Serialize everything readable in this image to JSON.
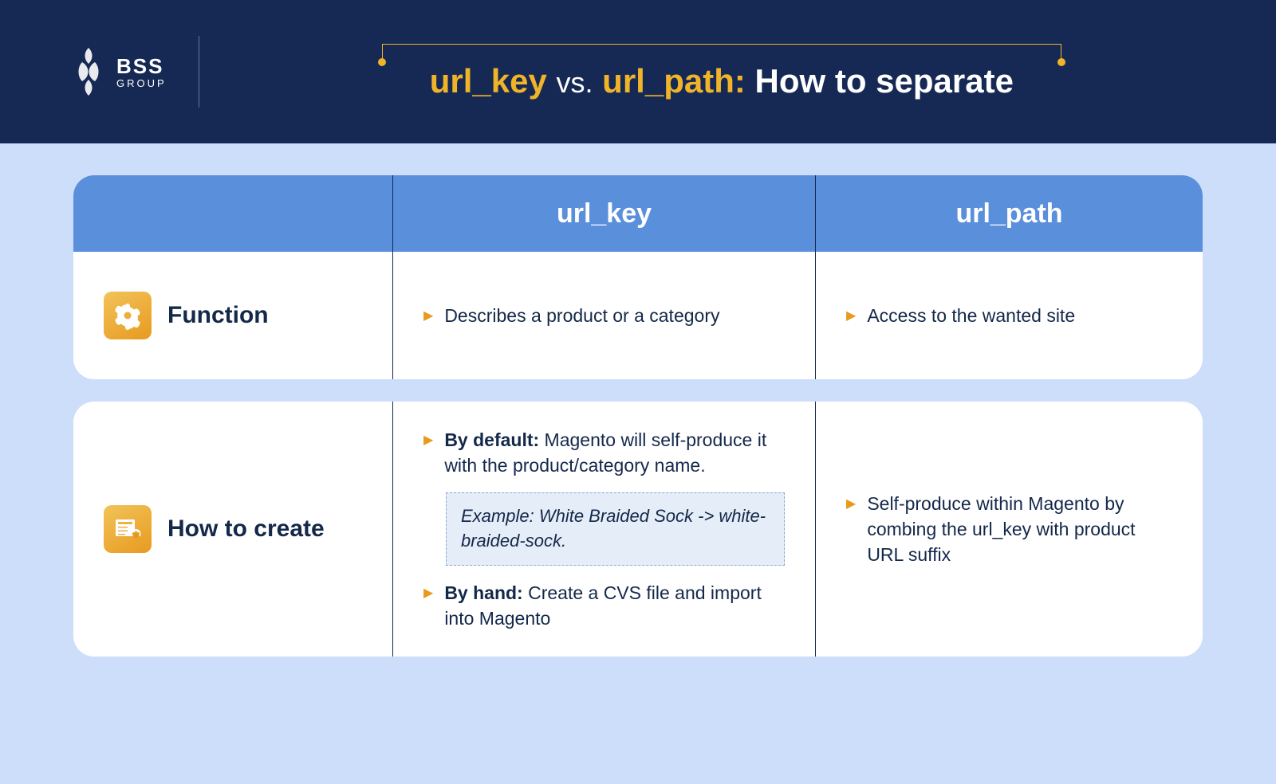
{
  "logo": {
    "line1": "BSS",
    "line2": "GROUP"
  },
  "title": {
    "part1": "url_key",
    "vs": "vs.",
    "part2": "url_path",
    "colon": ":",
    "rest": "How to separate"
  },
  "columns": {
    "col1": "",
    "col2": "url_key",
    "col3": "url_path"
  },
  "rows": [
    {
      "label": "Function",
      "urlkey": [
        {
          "text": "Describes a product or a category"
        }
      ],
      "urlpath": [
        {
          "text": "Access to the wanted site"
        }
      ]
    },
    {
      "label": "How to create",
      "urlkey": [
        {
          "strong": "By default:",
          "text": " Magento will self-produce it with the product/category name."
        },
        {
          "example": "Example: White Braided Sock -> white-braided-sock."
        },
        {
          "strong": "By hand:",
          "text": " Create a CVS file and import into Magento"
        }
      ],
      "urlpath": [
        {
          "text": "Self-produce within Magento by combing the url_key with product URL suffix"
        }
      ]
    }
  ]
}
